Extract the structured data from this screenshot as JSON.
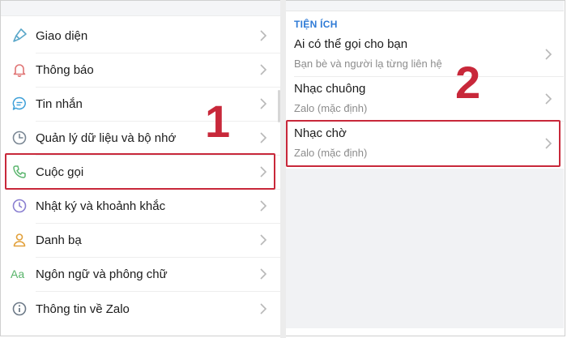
{
  "left_menu": {
    "items": [
      {
        "label": "Giao diện",
        "icon": "paint-brush-icon"
      },
      {
        "label": "Thông báo",
        "icon": "bell-icon"
      },
      {
        "label": "Tin nhắn",
        "icon": "chat-bubble-icon"
      },
      {
        "label": "Quản lý dữ liệu và bộ nhớ",
        "icon": "clock-pie-icon"
      },
      {
        "label": "Cuộc gọi",
        "icon": "phone-icon"
      },
      {
        "label": "Nhật ký và khoảnh khắc",
        "icon": "clock-icon"
      },
      {
        "label": "Danh bạ",
        "icon": "person-icon"
      },
      {
        "label": "Ngôn ngữ và phông chữ",
        "icon": "font-aa-icon"
      },
      {
        "label": "Thông tin về Zalo",
        "icon": "info-icon"
      }
    ]
  },
  "step_markers": {
    "one": "1",
    "two": "2"
  },
  "right_panel": {
    "section_title": "TIỆN ÍCH",
    "items": [
      {
        "title": "Ai có thể gọi cho bạn",
        "subtitle": "Bạn bè và người lạ từng liên hệ"
      },
      {
        "title": "Nhạc chuông",
        "subtitle": "Zalo (mặc định)"
      },
      {
        "title": "Nhạc chờ",
        "subtitle": "Zalo (mặc định)"
      }
    ]
  },
  "colors": {
    "highlight": "#c8283a",
    "accent": "#2f7bd6",
    "icon": "#5aa7c9"
  }
}
